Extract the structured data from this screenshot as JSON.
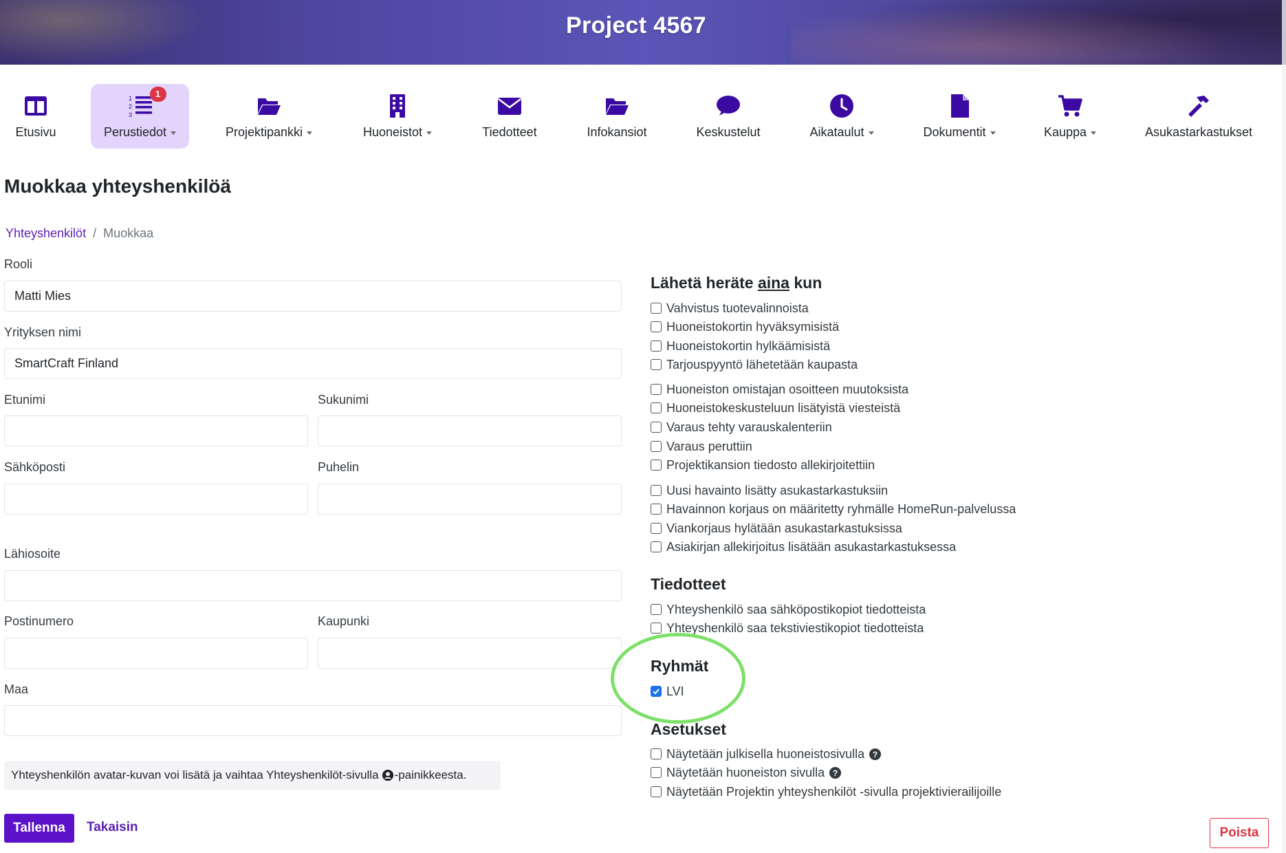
{
  "header": {
    "title": "Project 4567"
  },
  "nav": {
    "items": [
      {
        "label": "Etusivu",
        "icon": "layout-columns-icon",
        "dropdown": false,
        "active": false
      },
      {
        "label": "Perustiedot",
        "icon": "ordered-list-icon",
        "dropdown": true,
        "active": true,
        "badge": "1"
      },
      {
        "label": "Projektipankki",
        "icon": "folder-open-icon",
        "dropdown": true,
        "active": false
      },
      {
        "label": "Huoneistot",
        "icon": "building-icon",
        "dropdown": true,
        "active": false
      },
      {
        "label": "Tiedotteet",
        "icon": "envelope-icon",
        "dropdown": false,
        "active": false
      },
      {
        "label": "Infokansiot",
        "icon": "folder-open-icon",
        "dropdown": false,
        "active": false
      },
      {
        "label": "Keskustelut",
        "icon": "speech-bubble-icon",
        "dropdown": false,
        "active": false
      },
      {
        "label": "Aikataulut",
        "icon": "clock-icon",
        "dropdown": true,
        "active": false
      },
      {
        "label": "Dokumentit",
        "icon": "file-icon",
        "dropdown": true,
        "active": false
      },
      {
        "label": "Kauppa",
        "icon": "shopping-cart-icon",
        "dropdown": true,
        "active": false
      },
      {
        "label": "Asukastarkastukset",
        "icon": "hammer-icon",
        "dropdown": false,
        "active": false
      }
    ]
  },
  "page": {
    "title": "Muokkaa yhteyshenkilöä",
    "breadcrumb": {
      "link": "Yhteyshenkilöt",
      "current": "Muokkaa"
    }
  },
  "form": {
    "rooli": {
      "label": "Rooli",
      "value": "Matti Mies"
    },
    "yritys": {
      "label": "Yrityksen nimi",
      "value": "SmartCraft Finland"
    },
    "etunimi": {
      "label": "Etunimi",
      "value": ""
    },
    "sukunimi": {
      "label": "Sukunimi",
      "value": ""
    },
    "sahkoposti": {
      "label": "Sähköposti",
      "value": ""
    },
    "puhelin": {
      "label": "Puhelin",
      "value": ""
    },
    "lahiosoite": {
      "label": "Lähiosoite",
      "value": ""
    },
    "postinumero": {
      "label": "Postinumero",
      "value": ""
    },
    "kaupunki": {
      "label": "Kaupunki",
      "value": ""
    },
    "maa": {
      "label": "Maa",
      "value": ""
    },
    "note_before": "Yhteyshenkilön avatar-kuvan voi lisätä ja vaihtaa Yhteyshenkilöt-sivulla ",
    "note_after": "-painikkeesta.",
    "save_label": "Tallenna",
    "back_label": "Takaisin",
    "delete_label": "Poista"
  },
  "notifications": {
    "title_before": "Lähetä heräte ",
    "title_underlined": "aina",
    "title_after": " kun",
    "groups": [
      [
        "Vahvistus tuotevalinnoista",
        "Huoneistokortin hyväksymisistä",
        "Huoneistokortin hylkäämisistä",
        "Tarjouspyyntö lähetetään kaupasta"
      ],
      [
        "Huoneiston omistajan osoitteen muutoksista",
        "Huoneistokeskusteluun lisätyistä viesteistä",
        "Varaus tehty varauskalenteriin",
        "Varaus peruttiin",
        "Projektikansion tiedosto allekirjoitettiin"
      ],
      [
        "Uusi havainto lisätty asukastarkastuksiin",
        "Havainnon korjaus on määritetty ryhmälle HomeRun-palvelussa",
        "Viankorjaus hylätään asukastarkastuksissa",
        "Asiakirjan allekirjoitus lisätään asukastarkastuksessa"
      ]
    ]
  },
  "tiedotteet": {
    "title": "Tiedotteet",
    "items": [
      "Yhteyshenkilö saa sähköpostikopiot tiedotteista",
      "Yhteyshenkilö saa tekstiviestikopiot tiedotteista"
    ]
  },
  "ryhmat": {
    "title": "Ryhmät",
    "items": [
      {
        "label": "LVI",
        "checked": true
      }
    ]
  },
  "asetukset": {
    "title": "Asetukset",
    "items": [
      {
        "label": "Näytetään julkisella huoneistosivulla",
        "help": true
      },
      {
        "label": "Näytetään huoneiston sivulla",
        "help": true
      },
      {
        "label": "Näytetään Projektin yhteyshenkilöt -sivulla projektivierailijoille",
        "help": false
      }
    ]
  },
  "colors": {
    "accent": "#5b12c9",
    "nav_icon": "#3b0aa3",
    "active_nav_bg": "#e2d4fb",
    "danger": "#dc3545",
    "highlight": "#7ee06a"
  }
}
